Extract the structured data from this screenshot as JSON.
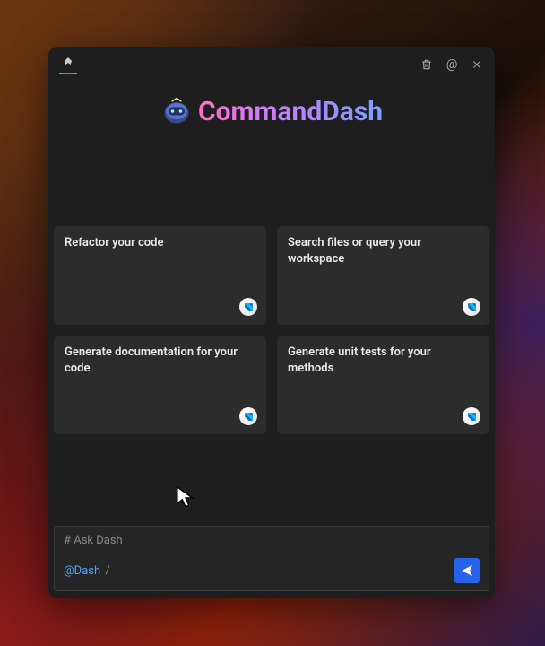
{
  "brand": {
    "title": "CommandDash"
  },
  "header": {
    "actions": {
      "trash": "trash-icon",
      "mention": "@",
      "close": "close-icon"
    }
  },
  "cards": [
    {
      "label": "Refactor your code"
    },
    {
      "label": "Search files or query your workspace"
    },
    {
      "label": "Generate documentation for your code"
    },
    {
      "label": "Generate unit tests for your methods"
    }
  ],
  "input": {
    "placeholder": "# Ask Dash",
    "mention": "@Dash",
    "slash": "/"
  },
  "colors": {
    "panel": "#1e1e1e",
    "card": "#2c2c2c",
    "accent": "#2563eb",
    "link": "#4fa3ff"
  }
}
